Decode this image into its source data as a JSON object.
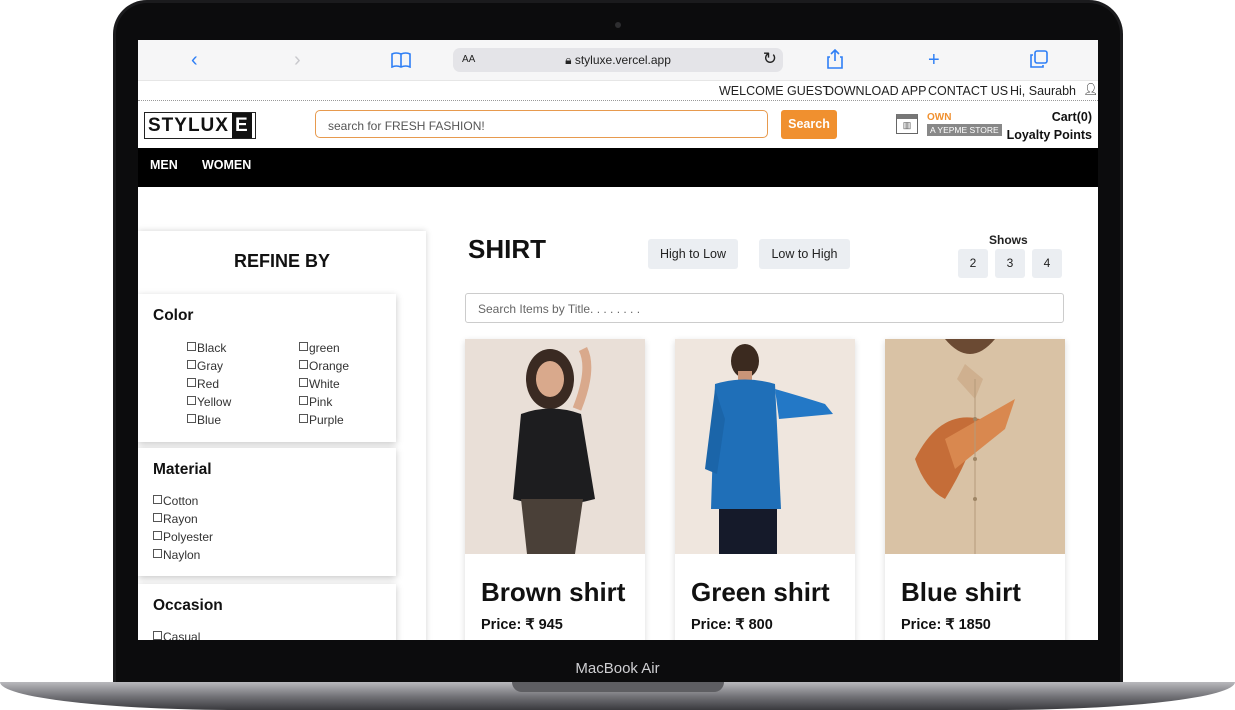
{
  "device": {
    "label": "MacBook Air"
  },
  "browser": {
    "aa": "AA",
    "url": "styluxe.vercel.app"
  },
  "topbar": {
    "welcome": "WELCOME GUEST",
    "download": "DOWNLOAD APP",
    "contact": "CONTACT US",
    "greeting": "Hi, Saurabh"
  },
  "header": {
    "logo_a": "STYLUX",
    "logo_b": "E",
    "search_placeholder": "search for FRESH FASHION!",
    "search_button": "Search",
    "own": "OWN",
    "yepme": "A YEPME STORE",
    "cart": "Cart(0)",
    "loyalty": "Loyalty Points"
  },
  "nav": {
    "men": "MEN",
    "women": "WOMEN"
  },
  "sidebar": {
    "title": "REFINE BY",
    "color": {
      "title": "Color",
      "options": [
        "Black",
        "Gray",
        "Red",
        "Yellow",
        "Blue",
        "green",
        "Orange",
        "White",
        "Pink",
        "Purple"
      ]
    },
    "material": {
      "title": "Material",
      "options": [
        "Cotton",
        "Rayon",
        "Polyester",
        "Naylon"
      ]
    },
    "occasion": {
      "title": "Occasion",
      "options": [
        "Casual"
      ]
    }
  },
  "main": {
    "title": "SHIRT",
    "sort_high": "High to Low",
    "sort_low": "Low to High",
    "shows_label": "Shows",
    "shows": [
      "2",
      "3",
      "4"
    ],
    "search_placeholder": "Search Items by Title. . . . . . . .",
    "products": [
      {
        "name": "Brown shirt",
        "price": "Price: ₹ 945"
      },
      {
        "name": "Green shirt",
        "price": "Price: ₹ 800"
      },
      {
        "name": "Blue shirt",
        "price": "Price: ₹ 1850"
      }
    ]
  },
  "colors": {
    "accent": "#f0902f",
    "nav": "#000000",
    "link": "#2f7ff5"
  }
}
